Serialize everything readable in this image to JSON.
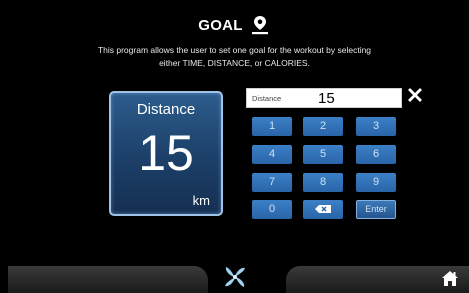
{
  "header": {
    "title": "GOAL",
    "icon": "location-pin-icon",
    "description_line1": "This program allows the user to set one goal for the workout by selecting",
    "description_line2": "either TIME, DISTANCE, or CALORIES."
  },
  "goal_panel": {
    "label": "Distance",
    "value": "15",
    "unit": "km"
  },
  "entry": {
    "label": "Distance",
    "value": "15"
  },
  "keypad": {
    "keys": [
      "1",
      "2",
      "3",
      "4",
      "5",
      "6",
      "7",
      "8",
      "9",
      "0",
      "backspace",
      "Enter"
    ],
    "enter_label": "Enter"
  },
  "colors": {
    "key_blue": "#3b80c6",
    "panel_blue": "#1c3f68",
    "panel_border": "#9fc3e6"
  },
  "footer": {
    "center_icon": "fan-icon",
    "right_icon": "home-icon"
  }
}
